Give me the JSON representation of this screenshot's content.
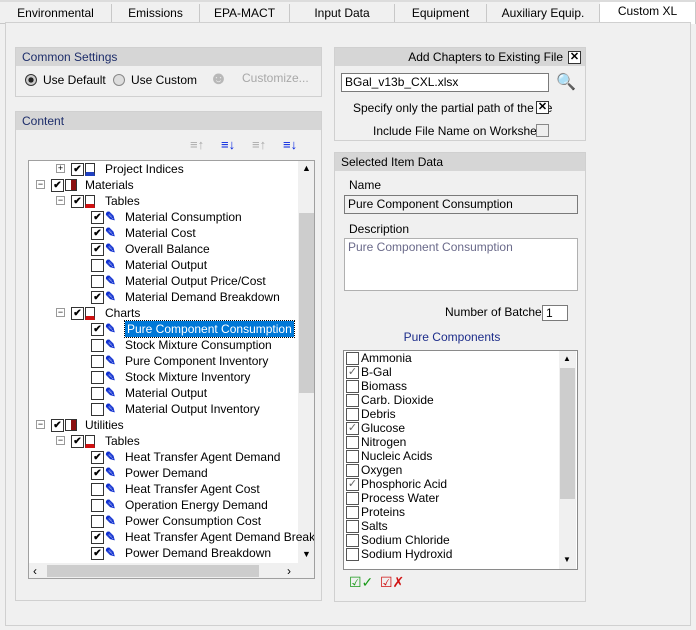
{
  "tabs": [
    {
      "label": "Environmental"
    },
    {
      "label": "Emissions"
    },
    {
      "label": "EPA-MACT"
    },
    {
      "label": "Input Data"
    },
    {
      "label": "Equipment"
    },
    {
      "label": "Auxiliary Equip."
    },
    {
      "label": "Custom XL",
      "active": true
    }
  ],
  "common_settings": {
    "title": "Common Settings",
    "use_default": "Use Default",
    "use_custom": "Use Custom",
    "customize": "Customize...",
    "selected": "Use Default"
  },
  "content": {
    "title": "Content",
    "toolbar": [
      "collapse-all-icon",
      "expand-all-checked-icon",
      "collapse-checked-icon",
      "expand-selected-icon"
    ],
    "tree": [
      {
        "label": "Project Indices",
        "level": 1,
        "checked": true,
        "expander": "+",
        "icon": "document-icon"
      },
      {
        "label": "Materials",
        "level": 0,
        "checked": true,
        "expander": "-",
        "icon": "book-icon"
      },
      {
        "label": "Tables",
        "level": 1,
        "checked": true,
        "expander": "-",
        "icon": "table-icon"
      },
      {
        "label": "Material Consumption",
        "level": 2,
        "checked": true,
        "icon": "pen-icon"
      },
      {
        "label": "Material Cost",
        "level": 2,
        "checked": true,
        "icon": "pen-icon"
      },
      {
        "label": "Overall Balance",
        "level": 2,
        "checked": true,
        "icon": "pen-icon"
      },
      {
        "label": "Material Output",
        "level": 2,
        "checked": false,
        "icon": "pen-icon"
      },
      {
        "label": "Material Output Price/Cost",
        "level": 2,
        "checked": false,
        "icon": "pen-icon"
      },
      {
        "label": "Material Demand Breakdown",
        "level": 2,
        "checked": true,
        "icon": "pen-icon"
      },
      {
        "label": "Charts",
        "level": 1,
        "checked": true,
        "expander": "-",
        "icon": "table-icon"
      },
      {
        "label": "Pure Component Consumption",
        "level": 2,
        "checked": true,
        "icon": "pen-icon",
        "selected": true
      },
      {
        "label": "Stock Mixture Consumption",
        "level": 2,
        "checked": false,
        "icon": "pen-icon"
      },
      {
        "label": "Pure Component Inventory",
        "level": 2,
        "checked": false,
        "icon": "pen-icon"
      },
      {
        "label": "Stock Mixture Inventory",
        "level": 2,
        "checked": false,
        "icon": "pen-icon"
      },
      {
        "label": "Material Output",
        "level": 2,
        "checked": false,
        "icon": "pen-icon"
      },
      {
        "label": "Material Output Inventory",
        "level": 2,
        "checked": false,
        "icon": "pen-icon"
      },
      {
        "label": "Utilities",
        "level": 0,
        "checked": true,
        "expander": "-",
        "icon": "book-icon"
      },
      {
        "label": "Tables",
        "level": 1,
        "checked": true,
        "expander": "-",
        "icon": "table-icon"
      },
      {
        "label": "Heat Transfer Agent Demand",
        "level": 2,
        "checked": true,
        "icon": "pen-icon"
      },
      {
        "label": "Power Demand",
        "level": 2,
        "checked": true,
        "icon": "pen-icon"
      },
      {
        "label": "Heat Transfer Agent Cost",
        "level": 2,
        "checked": false,
        "icon": "pen-icon"
      },
      {
        "label": "Operation Energy Demand",
        "level": 2,
        "checked": false,
        "icon": "pen-icon"
      },
      {
        "label": "Power Consumption Cost",
        "level": 2,
        "checked": false,
        "icon": "pen-icon"
      },
      {
        "label": "Heat Transfer Agent Demand Breakdown",
        "level": 2,
        "checked": true,
        "icon": "pen-icon"
      },
      {
        "label": "Power Demand Breakdown",
        "level": 2,
        "checked": true,
        "icon": "pen-icon"
      }
    ]
  },
  "add_chapters": {
    "title": "Add Chapters to Existing File",
    "checked": true,
    "file": "BGal_v13b_CXL.xlsx",
    "partial_path": "Specify only the partial path of the file",
    "partial_checked": true,
    "include_name": "Include File Name on Worksheet",
    "include_checked": false
  },
  "selected_item": {
    "title": "Selected Item Data",
    "name_label": "Name",
    "name": "Pure Component Consumption",
    "desc_label": "Description",
    "description": "Pure Component Consumption",
    "batches_label": "Number of Batches",
    "batches": "1",
    "components_label": "Pure Components",
    "components": [
      {
        "label": "Ammonia",
        "checked": false
      },
      {
        "label": "B-Gal",
        "checked": true
      },
      {
        "label": "Biomass",
        "checked": false
      },
      {
        "label": "Carb. Dioxide",
        "checked": false
      },
      {
        "label": "Debris",
        "checked": false
      },
      {
        "label": "Glucose",
        "checked": true
      },
      {
        "label": "Nitrogen",
        "checked": false
      },
      {
        "label": "Nucleic Acids",
        "checked": false
      },
      {
        "label": "Oxygen",
        "checked": false
      },
      {
        "label": "Phosphoric Acid",
        "checked": true
      },
      {
        "label": "Process Water",
        "checked": false
      },
      {
        "label": "Proteins",
        "checked": false
      },
      {
        "label": "Salts",
        "checked": false
      },
      {
        "label": "Sodium Chloride",
        "checked": false
      },
      {
        "label": "Sodium Hydroxid",
        "checked": false
      }
    ]
  }
}
